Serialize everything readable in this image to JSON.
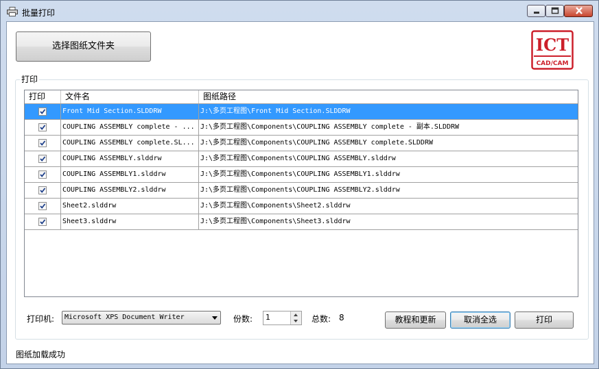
{
  "window": {
    "title": "批量打印"
  },
  "toolbar": {
    "select_folder_label": "选择图纸文件夹"
  },
  "logo": {
    "top_text": "ICT",
    "bottom_text": "CAD/CAM",
    "color": "#cc1f2a"
  },
  "print_group": {
    "label": "打印"
  },
  "grid": {
    "columns": [
      "打印",
      "文件名",
      "图纸路径"
    ],
    "rows": [
      {
        "checked": true,
        "name": "Front Mid Section.SLDDRW",
        "path": "J:\\多页工程图\\Front Mid Section.SLDDRW",
        "selected": true
      },
      {
        "checked": true,
        "name": "COUPLING ASSEMBLY complete - ...",
        "path": "J:\\多页工程图\\Components\\COUPLING ASSEMBLY complete - 副本.SLDDRW"
      },
      {
        "checked": true,
        "name": "COUPLING ASSEMBLY complete.SL...",
        "path": "J:\\多页工程图\\Components\\COUPLING ASSEMBLY complete.SLDDRW"
      },
      {
        "checked": true,
        "name": "COUPLING ASSEMBLY.slddrw",
        "path": "J:\\多页工程图\\Components\\COUPLING ASSEMBLY.slddrw"
      },
      {
        "checked": true,
        "name": "COUPLING ASSEMBLY1.slddrw",
        "path": "J:\\多页工程图\\Components\\COUPLING ASSEMBLY1.slddrw"
      },
      {
        "checked": true,
        "name": "COUPLING ASSEMBLY2.slddrw",
        "path": "J:\\多页工程图\\Components\\COUPLING ASSEMBLY2.slddrw"
      },
      {
        "checked": true,
        "name": "Sheet2.slddrw",
        "path": "J:\\多页工程图\\Components\\Sheet2.slddrw"
      },
      {
        "checked": true,
        "name": "Sheet3.slddrw",
        "path": "J:\\多页工程图\\Components\\Sheet3.slddrw"
      }
    ]
  },
  "bottom": {
    "printer_label": "打印机:",
    "printer_value": "Microsoft XPS Document Writer",
    "copies_label": "份数:",
    "copies_value": "1",
    "total_label": "总数:",
    "total_value": "8",
    "tutorial_label": "教程和更新",
    "deselect_label": "取消全选",
    "print_label": "打印"
  },
  "status": {
    "text": "图纸加载成功"
  }
}
